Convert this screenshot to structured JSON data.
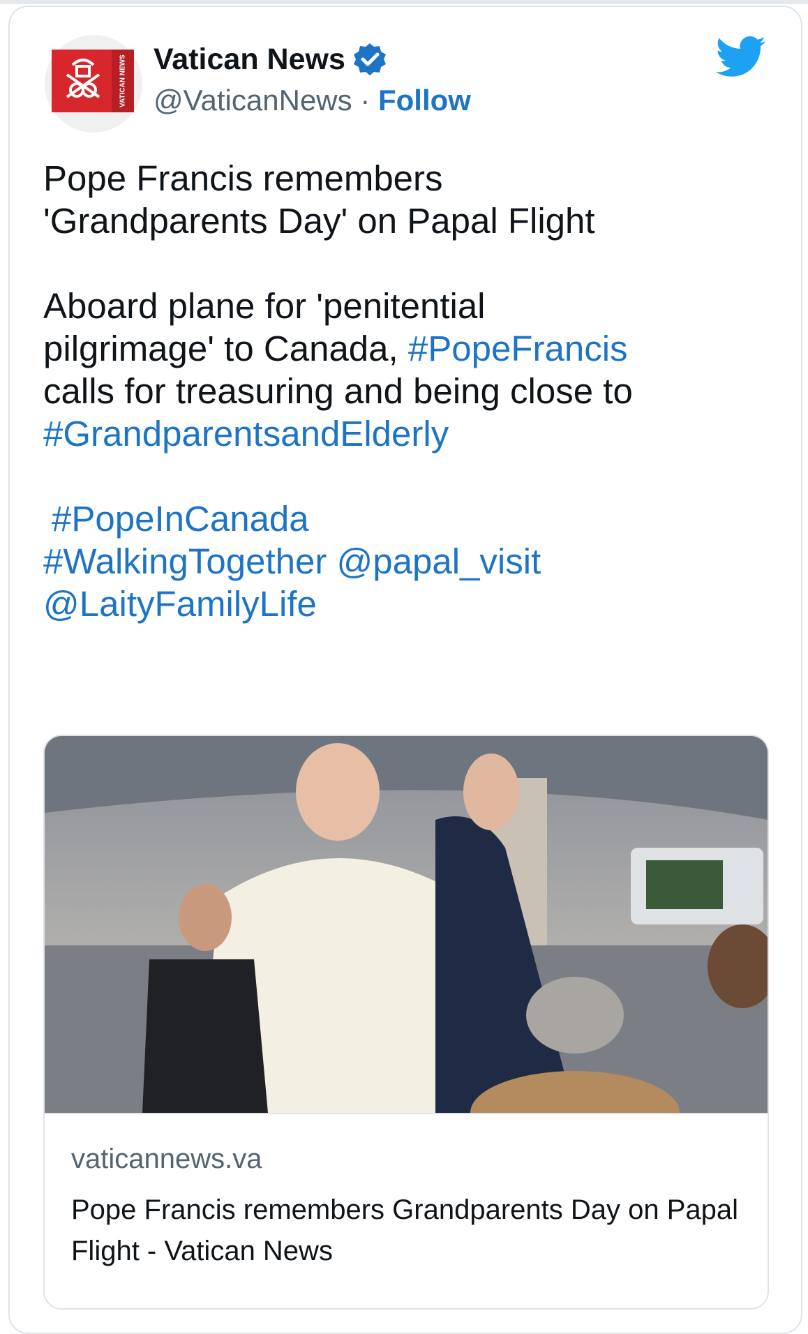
{
  "account": {
    "display_name": "Vatican News",
    "handle": "@VaticanNews",
    "separator": "·",
    "follow_label": "Follow",
    "logo_text": "VATICAN NEWS"
  },
  "tweet": {
    "line1": "Pope Francis remembers",
    "line2": "'Grandparents Day' on Papal Flight",
    "line3": "Aboard plane for 'penitential",
    "line4_text": "pilgrimage' to Canada,",
    "hashtag_popefrancis": "#PopeFrancis",
    "line5": "calls for treasuring and being close to",
    "hashtag_grandparents": "#GrandparentsandElderly",
    "hashtag_popeincanada": "#PopeInCanada",
    "hashtag_walking": "#WalkingTogether",
    "mention_papal": "@papal_visit",
    "mention_laity": "@LaityFamilyLife"
  },
  "link_card": {
    "domain": "vaticannews.va",
    "title": "Pope Francis remembers Grandparents Day on Papal Flight - Vatican News"
  },
  "colors": {
    "link": "#1d74c6",
    "logo_red": "#d8272c",
    "twitter_blue": "#1da1f2"
  },
  "icons": [
    "vatican-news-logo",
    "verified-badge-icon",
    "twitter-bird-icon"
  ]
}
